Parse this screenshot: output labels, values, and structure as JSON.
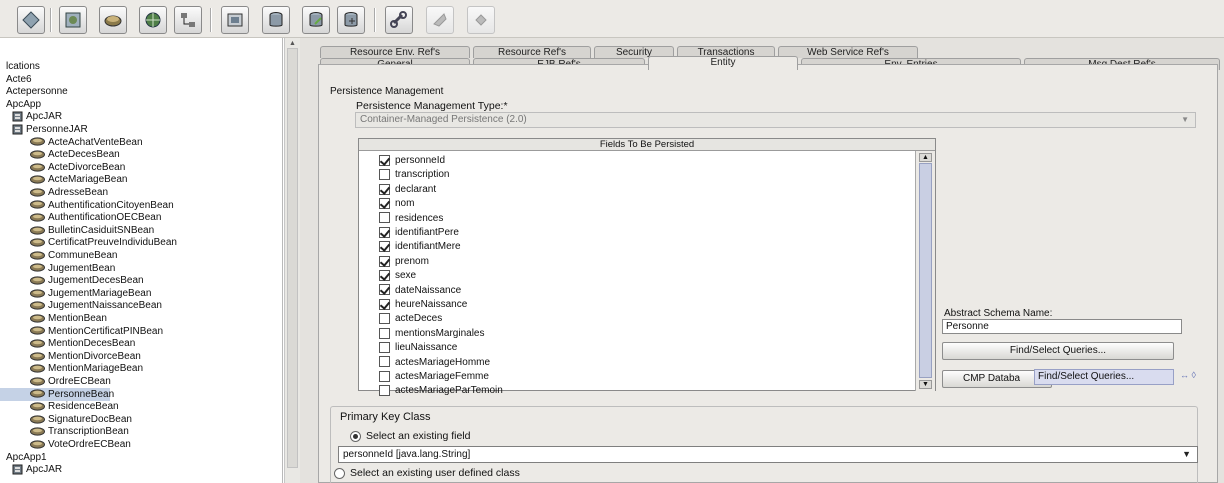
{
  "toolbar": {
    "buttons": [
      {
        "icon": "diamond-icon",
        "enabled": true
      },
      {
        "icon": "web-module-icon",
        "enabled": true
      },
      {
        "icon": "ejb-bean-icon",
        "enabled": true
      },
      {
        "icon": "globe-icon",
        "enabled": true
      },
      {
        "icon": "network-icon",
        "enabled": true
      },
      {
        "icon": "application-client-icon",
        "enabled": true
      },
      {
        "icon": "database-icon",
        "enabled": true
      },
      {
        "icon": "database-edit-icon",
        "enabled": true
      },
      {
        "icon": "database-add-icon",
        "enabled": true
      },
      {
        "icon": "link-icon",
        "enabled": true
      },
      {
        "icon": "connector-icon",
        "enabled": false
      },
      {
        "icon": "diamond-small-icon",
        "enabled": false
      }
    ]
  },
  "tree": {
    "items": [
      {
        "label": "lcations",
        "level": 0,
        "icon": "none"
      },
      {
        "label": "Acte6",
        "level": 0,
        "icon": "none"
      },
      {
        "label": "Actepersonne",
        "level": 0,
        "icon": "none"
      },
      {
        "label": "ApcApp",
        "level": 0,
        "icon": "none"
      },
      {
        "label": "ApcJAR",
        "level": 1,
        "icon": "jar-icon"
      },
      {
        "label": "PersonneJAR",
        "level": 1,
        "icon": "jar-icon"
      },
      {
        "label": "ActeAchatVenteBean",
        "level": 2,
        "icon": "bean-icon"
      },
      {
        "label": "ActeDecesBean",
        "level": 2,
        "icon": "bean-icon"
      },
      {
        "label": "ActeDivorceBean",
        "level": 2,
        "icon": "bean-icon"
      },
      {
        "label": "ActeMariageBean",
        "level": 2,
        "icon": "bean-icon"
      },
      {
        "label": "AdresseBean",
        "level": 2,
        "icon": "bean-icon"
      },
      {
        "label": "AuthentificationCitoyenBean",
        "level": 2,
        "icon": "bean-icon"
      },
      {
        "label": "AuthentificationOECBean",
        "level": 2,
        "icon": "bean-icon"
      },
      {
        "label": "BulletinCasiduitSNBean",
        "level": 2,
        "icon": "bean-icon"
      },
      {
        "label": "CertificatPreuveIndividuBean",
        "level": 2,
        "icon": "bean-icon"
      },
      {
        "label": "CommuneBean",
        "level": 2,
        "icon": "bean-icon"
      },
      {
        "label": "JugementBean",
        "level": 2,
        "icon": "bean-icon"
      },
      {
        "label": "JugementDecesBean",
        "level": 2,
        "icon": "bean-icon"
      },
      {
        "label": "JugementMariageBean",
        "level": 2,
        "icon": "bean-icon"
      },
      {
        "label": "JugementNaissanceBean",
        "level": 2,
        "icon": "bean-icon"
      },
      {
        "label": "MentionBean",
        "level": 2,
        "icon": "bean-icon"
      },
      {
        "label": "MentionCertificatPINBean",
        "level": 2,
        "icon": "bean-icon"
      },
      {
        "label": "MentionDecesBean",
        "level": 2,
        "icon": "bean-icon"
      },
      {
        "label": "MentionDivorceBean",
        "level": 2,
        "icon": "bean-icon"
      },
      {
        "label": "MentionMariageBean",
        "level": 2,
        "icon": "bean-icon"
      },
      {
        "label": "OrdreECBean",
        "level": 2,
        "icon": "bean-icon"
      },
      {
        "label": "PersonneBean",
        "level": 2,
        "icon": "bean-icon",
        "selected": true
      },
      {
        "label": "ResidenceBean",
        "level": 2,
        "icon": "bean-icon"
      },
      {
        "label": "SignatureDocBean",
        "level": 2,
        "icon": "bean-icon"
      },
      {
        "label": "TranscriptionBean",
        "level": 2,
        "icon": "bean-icon"
      },
      {
        "label": "VoteOrdreECBean",
        "level": 2,
        "icon": "bean-icon"
      },
      {
        "label": "ApcApp1",
        "level": 0,
        "icon": "none"
      },
      {
        "label": "ApcJAR",
        "level": 1,
        "icon": "jar-icon"
      }
    ]
  },
  "tabs": {
    "row1": [
      "Resource Env. Ref's",
      "Resource Ref's",
      "Security",
      "Transactions",
      "Web Service Ref's"
    ],
    "row2": [
      "General",
      "EJB Ref's",
      "Entity",
      "Env. Entries",
      "Msg Dest Ref's"
    ],
    "active": "Entity"
  },
  "persistence": {
    "group_title": "Persistence Management",
    "type_label": "Persistence Management Type:*",
    "type_value": "Container-Managed Persistence (2.0)",
    "fields_header": "Fields To Be Persisted",
    "fields": [
      {
        "name": "personneId",
        "checked": true
      },
      {
        "name": "transcription",
        "checked": false
      },
      {
        "name": "declarant",
        "checked": true
      },
      {
        "name": "nom",
        "checked": true
      },
      {
        "name": "residences",
        "checked": false
      },
      {
        "name": "identifiantPere",
        "checked": true
      },
      {
        "name": "identifiantMere",
        "checked": true
      },
      {
        "name": "prenom",
        "checked": true
      },
      {
        "name": "sexe",
        "checked": true
      },
      {
        "name": "dateNaissance",
        "checked": true
      },
      {
        "name": "heureNaissance",
        "checked": true
      },
      {
        "name": "acteDeces",
        "checked": false
      },
      {
        "name": "mentionsMarginales",
        "checked": false
      },
      {
        "name": "lieuNaissance",
        "checked": false
      },
      {
        "name": "actesMariageHomme",
        "checked": false
      },
      {
        "name": "actesMariageFemme",
        "checked": false
      },
      {
        "name": "actesMariageParTemoin",
        "checked": false
      }
    ],
    "abstract_schema_label": "Abstract Schema Name:",
    "abstract_schema_value": "Personne",
    "find_select_button": "Find/Select Queries...",
    "cmp_database_button": "CMP Databa",
    "tooltip": "Find/Select Queries..."
  },
  "primary_key": {
    "group_title": "Primary Key Class",
    "option_existing_field": "Select an existing field",
    "field_value": "personneId [java.lang.String]",
    "option_user_defined": "Select an existing user defined class"
  }
}
